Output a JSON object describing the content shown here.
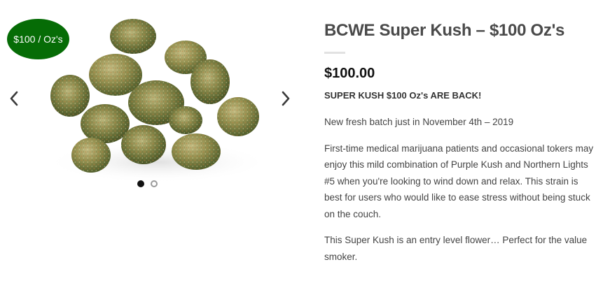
{
  "product": {
    "badge": "$100 / Oz's",
    "title": "BCWE Super Kush – $100 Oz's",
    "price": "$100.00",
    "headline": "SUPER KUSH $100 Oz's ARE BACK!",
    "paragraph_1": "New fresh batch just in November 4th – 2019",
    "paragraph_2": "First-time medical marijuana patients and occasional tokers may enjoy this mild combination of Purple Kush and Northern Lights #5 when you're looking to wind down and relax. This strain is best for users who would like to ease stress without being stuck on the couch.",
    "paragraph_3": "This Super Kush is an entry level flower… Perfect for the value smoker."
  },
  "gallery": {
    "image_subject": "cannabis buds",
    "prev_icon": "chevron-left-icon",
    "next_icon": "chevron-right-icon",
    "slide_count": 2,
    "active_slide": 1
  },
  "colors": {
    "badge_bg": "#066c06",
    "badge_text": "#ffffff",
    "title": "#4a4a4a",
    "price": "#111111",
    "divider": "#e2e2e2",
    "dot_active": "#111111",
    "dot_inactive": "#9a9a9a"
  }
}
